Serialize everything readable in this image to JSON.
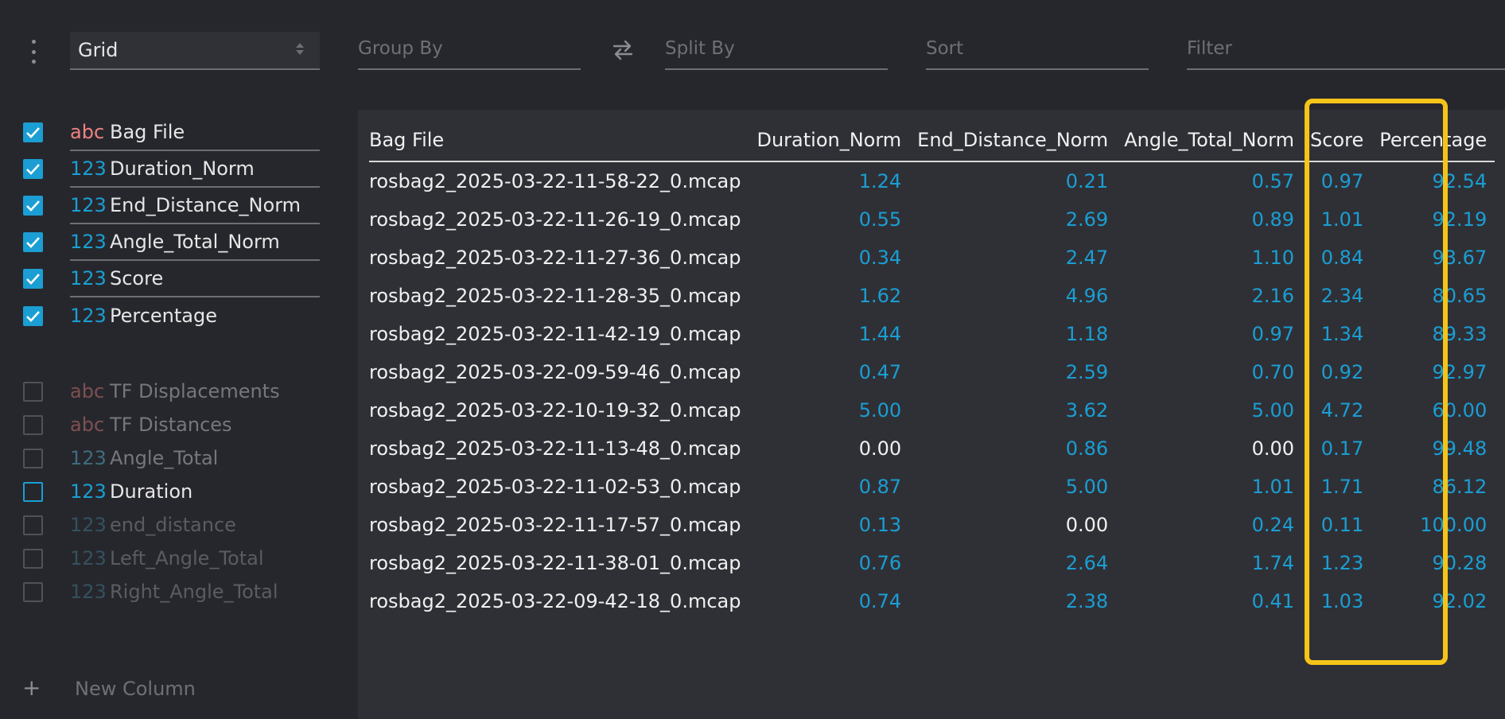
{
  "toolbar": {
    "plugin_value": "Grid",
    "group_by_placeholder": "Group By",
    "split_by_placeholder": "Split By",
    "sort_placeholder": "Sort",
    "filter_placeholder": "Filter"
  },
  "columns": {
    "active": [
      {
        "type": "abc",
        "name": "Bag File",
        "checked": true
      },
      {
        "type": "123",
        "name": "Duration_Norm",
        "checked": true
      },
      {
        "type": "123",
        "name": "End_Distance_Norm",
        "checked": true
      },
      {
        "type": "123",
        "name": "Angle_Total_Norm",
        "checked": true
      },
      {
        "type": "123",
        "name": "Score",
        "checked": true
      },
      {
        "type": "123",
        "name": "Percentage",
        "checked": true
      }
    ],
    "inactive": [
      {
        "type": "abc",
        "name": "TF Displacements",
        "checked": false
      },
      {
        "type": "abc",
        "name": "TF Distances",
        "checked": false
      },
      {
        "type": "123",
        "name": "Angle_Total",
        "checked": false
      },
      {
        "type": "123",
        "name": "Duration",
        "checked": false
      },
      {
        "type": "123",
        "name": "end_distance",
        "checked": false
      },
      {
        "type": "123",
        "name": "Left_Angle_Total",
        "checked": false
      },
      {
        "type": "123",
        "name": "Right_Angle_Total",
        "checked": false
      }
    ],
    "new_column_label": "New Column",
    "new_column_icon": "+"
  },
  "grid": {
    "headers": [
      "Bag File",
      "Duration_Norm",
      "End_Distance_Norm",
      "Angle_Total_Norm",
      "Score",
      "Percentage"
    ],
    "rows": [
      [
        "rosbag2_2025-03-22-11-58-22_0.mcap",
        "1.24",
        "0.21",
        "0.57",
        "0.97",
        "92.54"
      ],
      [
        "rosbag2_2025-03-22-11-26-19_0.mcap",
        "0.55",
        "2.69",
        "0.89",
        "1.01",
        "92.19"
      ],
      [
        "rosbag2_2025-03-22-11-27-36_0.mcap",
        "0.34",
        "2.47",
        "1.10",
        "0.84",
        "93.67"
      ],
      [
        "rosbag2_2025-03-22-11-28-35_0.mcap",
        "1.62",
        "4.96",
        "2.16",
        "2.34",
        "80.65"
      ],
      [
        "rosbag2_2025-03-22-11-42-19_0.mcap",
        "1.44",
        "1.18",
        "0.97",
        "1.34",
        "89.33"
      ],
      [
        "rosbag2_2025-03-22-09-59-46_0.mcap",
        "0.47",
        "2.59",
        "0.70",
        "0.92",
        "92.97"
      ],
      [
        "rosbag2_2025-03-22-10-19-32_0.mcap",
        "5.00",
        "3.62",
        "5.00",
        "4.72",
        "60.00"
      ],
      [
        "rosbag2_2025-03-22-11-13-48_0.mcap",
        "0.00",
        "0.86",
        "0.00",
        "0.17",
        "99.48"
      ],
      [
        "rosbag2_2025-03-22-11-02-53_0.mcap",
        "0.87",
        "5.00",
        "1.01",
        "1.71",
        "86.12"
      ],
      [
        "rosbag2_2025-03-22-11-17-57_0.mcap",
        "0.13",
        "0.00",
        "0.24",
        "0.11",
        "100.00"
      ],
      [
        "rosbag2_2025-03-22-11-38-01_0.mcap",
        "0.76",
        "2.64",
        "1.74",
        "1.23",
        "90.28"
      ],
      [
        "rosbag2_2025-03-22-09-42-18_0.mcap",
        "0.74",
        "2.38",
        "0.41",
        "1.03",
        "92.02"
      ]
    ]
  },
  "colors": {
    "accent": "#1a9ed3",
    "string_type": "#f08181",
    "highlight": "#f5c419"
  }
}
